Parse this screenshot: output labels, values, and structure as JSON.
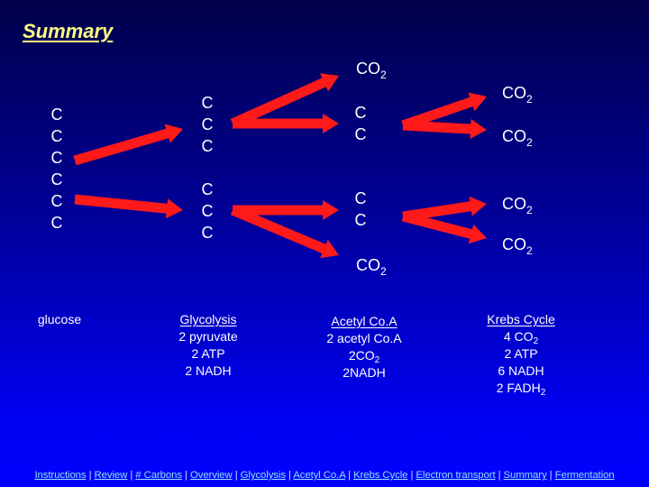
{
  "slide": {
    "title": "Summary",
    "colors": {
      "background_top": "#00004a",
      "background_bottom": "#0000ff",
      "title": "#ffff80",
      "arrow": "#ff1a1a",
      "text": "#ffffff",
      "nav_link": "#90e0ff"
    }
  },
  "diagram": {
    "glucose_carbons": [
      "C",
      "C",
      "C",
      "C",
      "C",
      "C"
    ],
    "pyruvate_top": [
      "C",
      "C",
      "C"
    ],
    "pyruvate_bottom": [
      "C",
      "C",
      "C"
    ],
    "acetyl_top": [
      "C",
      "C"
    ],
    "acetyl_bottom": [
      "C",
      "C"
    ],
    "co2_label": "CO",
    "co2_sub": "2"
  },
  "stages": {
    "glucose": {
      "heading": "glucose"
    },
    "glycolysis": {
      "heading": "Glycolysis",
      "lines": [
        "2 pyruvate",
        "2 ATP",
        "2 NADH"
      ]
    },
    "acetyl_coa": {
      "heading": "Acetyl Co.A",
      "line1": "2 acetyl Co.A",
      "line2_pre": "2CO",
      "line2_sub": "2",
      "line3": "2NADH"
    },
    "krebs": {
      "heading": "Krebs Cycle",
      "line1_pre": "4 CO",
      "line1_sub": "2",
      "line2": "2 ATP",
      "line3": "6 NADH",
      "line4_pre": "2 FADH",
      "line4_sub": "2"
    }
  },
  "nav": {
    "links": [
      "Instructions",
      "Review",
      "# Carbons",
      "Overview",
      "Glycolysis",
      "Acetyl Co.A",
      "Krebs Cycle",
      "Electron transport",
      "Summary",
      "Fermentation"
    ],
    "separator": "|"
  }
}
